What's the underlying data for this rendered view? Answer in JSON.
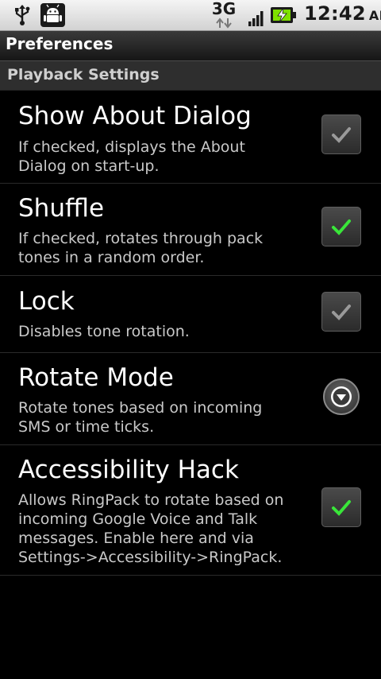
{
  "status_bar": {
    "network": "3G",
    "time": "12:42",
    "ampm": "AM",
    "icons": [
      "usb-icon",
      "android-debug-icon",
      "data-arrows-icon",
      "signal-icon",
      "battery-charging-icon"
    ],
    "colors": {
      "background": "#e0e0e0",
      "battery_charge": "#7ee000"
    }
  },
  "title": "Preferences",
  "category": "Playback Settings",
  "preferences": [
    {
      "title": "Show About Dialog",
      "summary": "If checked, displays the About Dialog on start-up.",
      "widget": "checkbox",
      "checked": false
    },
    {
      "title": "Shuffle",
      "summary": "If checked, rotates through pack tones in a random order.",
      "widget": "checkbox",
      "checked": true
    },
    {
      "title": "Lock",
      "summary": "Disables tone rotation.",
      "widget": "checkbox",
      "checked": false
    },
    {
      "title": "Rotate Mode",
      "summary": "Rotate tones based on incoming SMS or time ticks.",
      "widget": "dropdown"
    },
    {
      "title": "Accessibility Hack",
      "summary": "Allows RingPack to rotate based on incoming Google Voice and Talk messages. Enable here and via Settings->Accessibility->RingPack.",
      "widget": "checkbox",
      "checked": true
    }
  ],
  "colors": {
    "check_on": "#39e639",
    "check_off": "#9a9a9a"
  }
}
